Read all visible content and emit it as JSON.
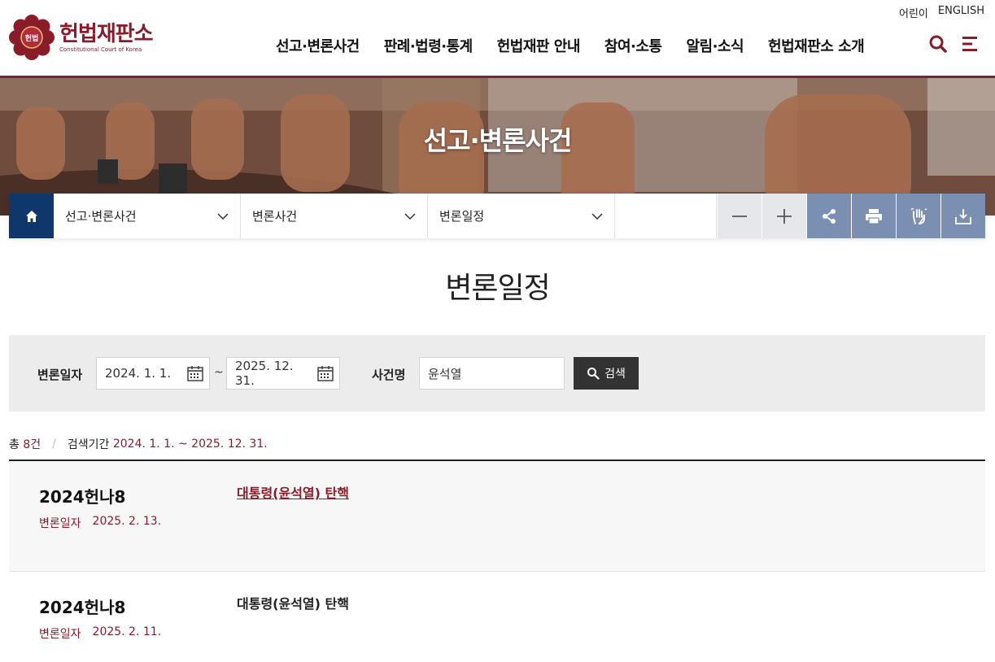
{
  "header": {
    "util_links": [
      "어린이",
      "ENGLISH"
    ],
    "logo": {
      "emblem_text": "헌법",
      "title_kr": "헌법재판소",
      "title_en": "Constitutional Court of Korea"
    },
    "gnb": [
      "선고·변론사건",
      "판례·법령·통계",
      "헌법재판 안내",
      "참여·소통",
      "알림·소식",
      "헌법재판소 소개"
    ]
  },
  "banner": {
    "title": "선고·변론사건"
  },
  "location": {
    "items": [
      "선고·변론사건",
      "변론사건",
      "변론일정"
    ],
    "tool_icons": [
      "zoom-out-icon",
      "zoom-in-icon",
      "share-icon",
      "print-icon",
      "gesture-icon",
      "download-icon"
    ]
  },
  "page": {
    "title": "변론일정"
  },
  "search": {
    "date_label": "변론일자",
    "date_from": "2024. 1. 1.",
    "date_to": "2025. 12. 31.",
    "tilde": "~",
    "case_label": "사건명",
    "case_value": "윤석열",
    "button": "검색"
  },
  "summary": {
    "total_prefix": "총",
    "count": "8건",
    "period_label": "검색기간",
    "period_value": "2024. 1. 1. ~ 2025. 12. 31."
  },
  "results": [
    {
      "case_no": "2024헌나8",
      "date_label": "변론일자",
      "date": "2025. 2. 13.",
      "name": "대통령(윤석열) 탄핵"
    },
    {
      "case_no": "2024헌나8",
      "date_label": "변론일자",
      "date": "2025. 2. 11.",
      "name": "대통령(윤석열) 탄핵"
    }
  ],
  "colors": {
    "brand": "#8a1c2a",
    "navy": "#10376b",
    "tool_blue": "#7a8fb1"
  }
}
